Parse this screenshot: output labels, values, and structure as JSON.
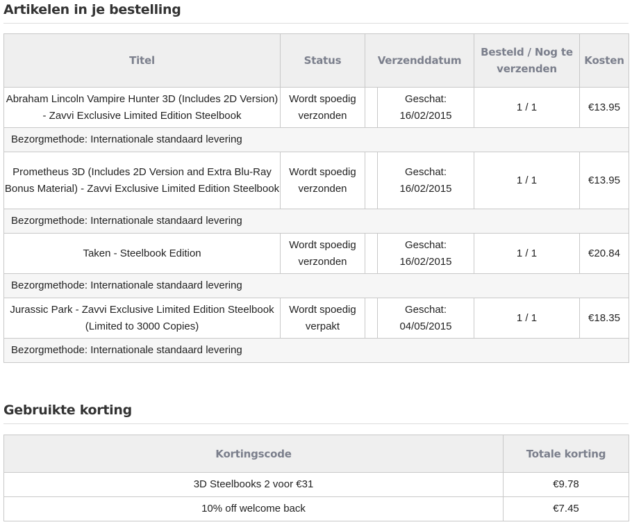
{
  "order_items": {
    "title": "Artikelen in je bestelling",
    "headers": {
      "title": "Titel",
      "status": "Status",
      "shipdate": "Verzenddatum",
      "qty": "Besteld / Nog te verzenden",
      "cost": "Kosten"
    },
    "items": [
      {
        "title": "Abraham Lincoln Vampire Hunter 3D (Includes 2D Version) - Zavvi Exclusive Limited Edition Steelbook",
        "status": "Wordt spoedig verzonden",
        "date_label": "Geschat:",
        "date": "16/02/2015",
        "qty": "1 / 1",
        "cost": "€13.95",
        "method": "Bezorgmethode: Internationale standaard levering"
      },
      {
        "title": "Prometheus 3D (Includes 2D Version and Extra Blu-Ray Bonus Material) - Zavvi Exclusive Limited Edition Steelbook",
        "status": "Wordt spoedig verzonden",
        "date_label": "Geschat:",
        "date": "16/02/2015",
        "qty": "1 / 1",
        "cost": "€13.95",
        "method": "Bezorgmethode: Internationale standaard levering"
      },
      {
        "title": "Taken - Steelbook Edition",
        "status": "Wordt spoedig verzonden",
        "date_label": "Geschat:",
        "date": "16/02/2015",
        "qty": "1 / 1",
        "cost": "€20.84",
        "method": "Bezorgmethode: Internationale standaard levering"
      },
      {
        "title": "Jurassic Park - Zavvi Exclusive Limited Edition Steelbook (Limited to 3000 Copies)",
        "status": "Wordt spoedig verpakt",
        "date_label": "Geschat:",
        "date": "04/05/2015",
        "qty": "1 / 1",
        "cost": "€18.35",
        "method": "Bezorgmethode: Internationale standaard levering"
      }
    ]
  },
  "discounts": {
    "title": "Gebruikte korting",
    "headers": {
      "code": "Kortingscode",
      "total": "Totale korting"
    },
    "rows": [
      {
        "code": "3D Steelbooks 2 voor €31",
        "total": "€9.78"
      },
      {
        "code": "10% off welcome back",
        "total": "€7.45"
      }
    ]
  }
}
